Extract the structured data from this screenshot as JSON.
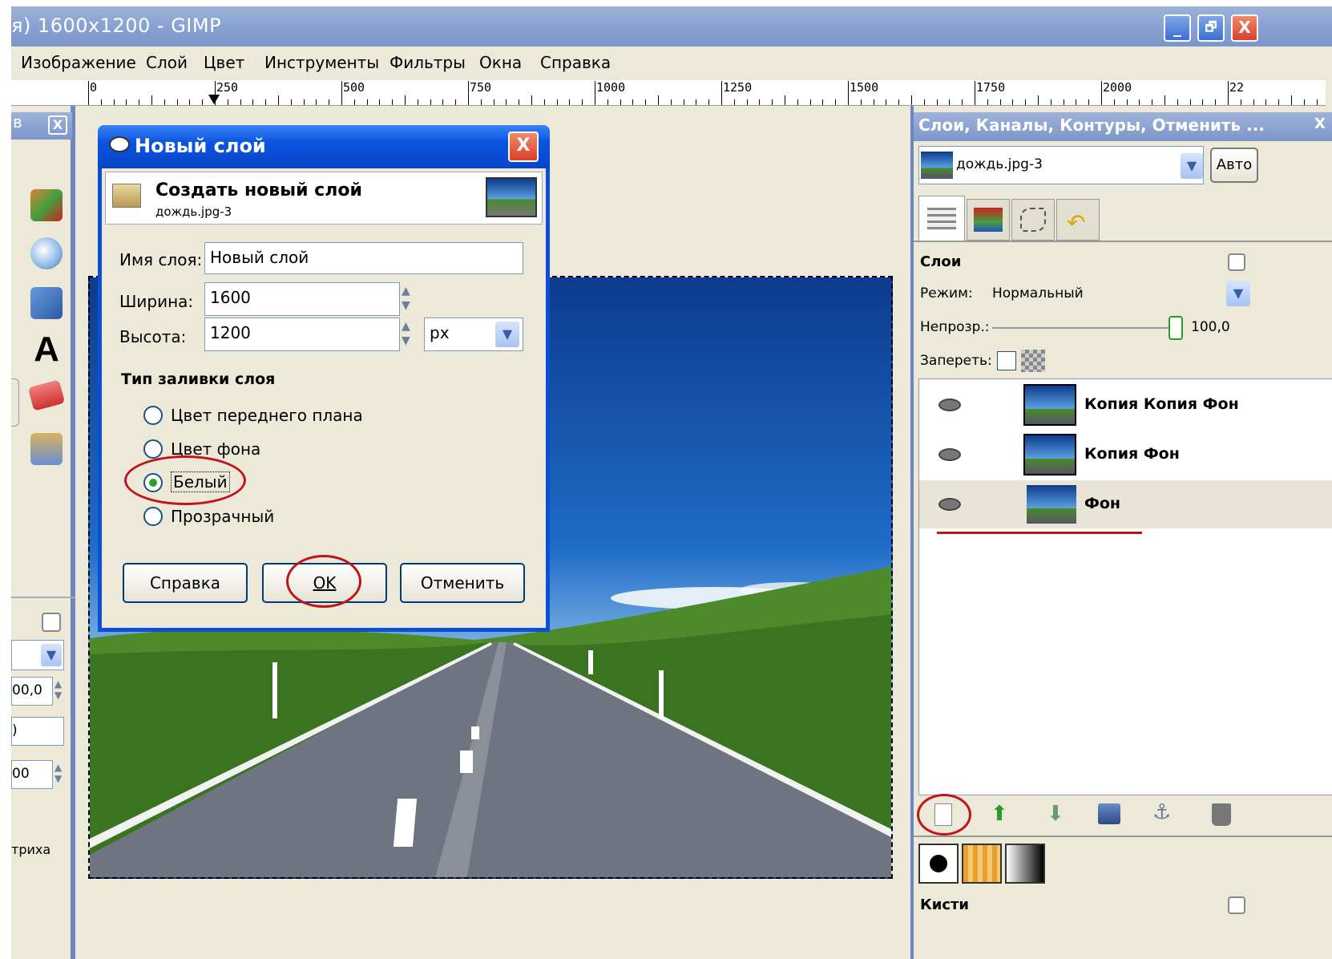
{
  "window": {
    "title": "я) 1600x1200 - GIMP",
    "minimize_icon": "_",
    "maximize_icon": "🗗",
    "close_icon": "X"
  },
  "menu": [
    "Изображение",
    "Слой",
    "Цвет",
    "Инструменты",
    "Фильтры",
    "Окна",
    "Справка"
  ],
  "ruler": {
    "labels": [
      "0",
      "250",
      "500",
      "750",
      "1000",
      "1250",
      "1500",
      "1750",
      "2000",
      "22"
    ]
  },
  "toolbox": {
    "title": "в",
    "close": "X",
    "value1": "00,0",
    "value2": ")",
    "value3": "00",
    "label": "триха"
  },
  "dialog": {
    "title": "Новый слой",
    "heading": "Создать новый слой",
    "subheading": "дождь.jpg-3",
    "name_label": "Имя слоя:",
    "name_value": "Новый слой",
    "width_label": "Ширина:",
    "width_value": "1600",
    "height_label": "Высота:",
    "height_value": "1200",
    "unit": "px",
    "fill_heading": "Тип заливки слоя",
    "fill_options": [
      "Цвет переднего плана",
      "Цвет фона",
      "Белый",
      "Прозрачный"
    ],
    "selected_fill": "Белый",
    "buttons": {
      "help": "Справка",
      "ok": "OK",
      "cancel": "Отменить"
    }
  },
  "dock": {
    "title": "Слои, Каналы, Контуры, Отменить ...",
    "image_select": "дождь.jpg-3",
    "auto_button": "Авто",
    "layers_label": "Слои",
    "mode_label": "Режим:",
    "mode_value": "Нормальный",
    "opacity_label": "Непрозр.:",
    "opacity_value": "100,0",
    "lock_label": "Запереть:",
    "layers": [
      "Копия Копия Фон",
      "Копия Фон",
      "Фон"
    ],
    "brushes_label": "Кисти"
  },
  "colors": {
    "accent": "#0a54e0",
    "highlight": "#c0141a"
  }
}
